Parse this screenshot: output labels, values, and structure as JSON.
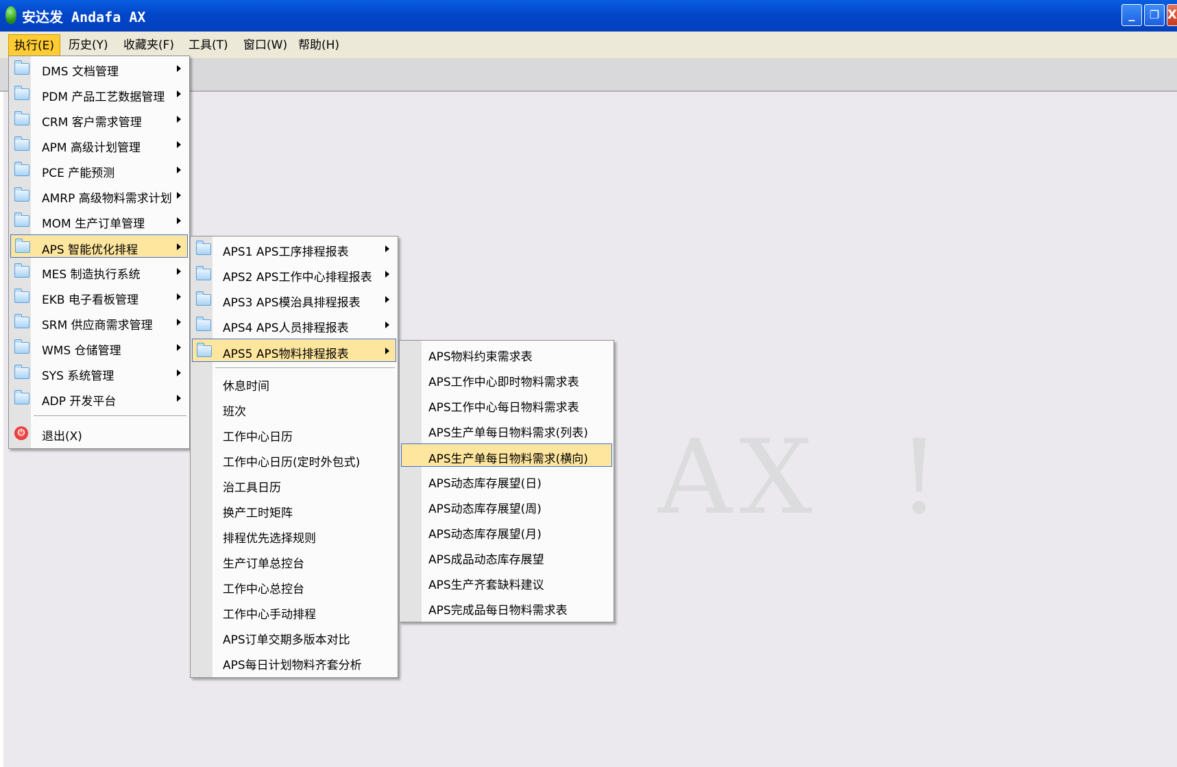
{
  "window": {
    "title": "安达发 Andafa AX",
    "buttons": {
      "minimize": "_",
      "restore": "❐",
      "close": "X"
    }
  },
  "menubar": {
    "items": [
      {
        "label": "执行(E)"
      },
      {
        "label": "历史(Y)"
      },
      {
        "label": "收藏夹(F)"
      },
      {
        "label": "工具(T)"
      },
      {
        "label": "窗口(W)"
      },
      {
        "label": "帮助(H)"
      }
    ]
  },
  "watermark": "AX  !",
  "menu1": {
    "items": [
      {
        "label": "DMS 文档管理"
      },
      {
        "label": "PDM 产品工艺数据管理"
      },
      {
        "label": "CRM 客户需求管理"
      },
      {
        "label": "APM 高级计划管理"
      },
      {
        "label": "PCE 产能预测"
      },
      {
        "label": "AMRP 高级物料需求计划"
      },
      {
        "label": "MOM 生产订单管理"
      },
      {
        "label": "APS 智能优化排程"
      },
      {
        "label": "MES 制造执行系统"
      },
      {
        "label": "EKB 电子看板管理"
      },
      {
        "label": "SRM 供应商需求管理"
      },
      {
        "label": "WMS 仓储管理"
      },
      {
        "label": "SYS 系统管理"
      },
      {
        "label": "ADP 开发平台"
      }
    ],
    "exit": {
      "label": "退出(X)",
      "icon": "exit-icon"
    }
  },
  "menu2": {
    "submenus": [
      {
        "label": "APS1 APS工序排程报表"
      },
      {
        "label": "APS2 APS工作中心排程报表"
      },
      {
        "label": "APS3 APS模治具排程报表"
      },
      {
        "label": "APS4 APS人员排程报表"
      },
      {
        "label": "APS5 APS物料排程报表"
      }
    ],
    "items": [
      {
        "label": "休息时间"
      },
      {
        "label": "班次"
      },
      {
        "label": "工作中心日历"
      },
      {
        "label": "工作中心日历(定时外包式)"
      },
      {
        "label": "治工具日历"
      },
      {
        "label": "换产工时矩阵"
      },
      {
        "label": "排程优先选择规则"
      },
      {
        "label": "生产订单总控台"
      },
      {
        "label": "工作中心总控台"
      },
      {
        "label": "工作中心手动排程"
      },
      {
        "label": "APS订单交期多版本对比"
      },
      {
        "label": "APS每日计划物料齐套分析"
      }
    ]
  },
  "menu3": {
    "items": [
      {
        "label": "APS物料约束需求表"
      },
      {
        "label": "APS工作中心即时物料需求表"
      },
      {
        "label": "APS工作中心每日物料需求表"
      },
      {
        "label": "APS生产单每日物料需求(列表)"
      },
      {
        "label": "APS生产单每日物料需求(横向)"
      },
      {
        "label": "APS动态库存展望(日)"
      },
      {
        "label": "APS动态库存展望(周)"
      },
      {
        "label": "APS动态库存展望(月)"
      },
      {
        "label": "APS成品动态库存展望"
      },
      {
        "label": "APS生产齐套缺料建议"
      },
      {
        "label": "APS完成品每日物料需求表"
      }
    ]
  }
}
